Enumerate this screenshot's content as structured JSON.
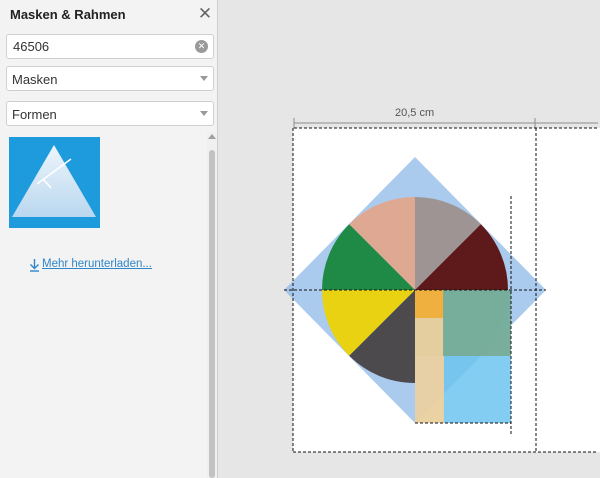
{
  "panel": {
    "title": "Masken & Rahmen",
    "close_icon": "close-icon",
    "search": {
      "value": "46506",
      "placeholder": ""
    },
    "category": "Masken",
    "subcategory": "Formen",
    "thumbnail_icon": "triangle-mask-icon",
    "download_icon": "download-arrow-icon",
    "download_label": "Mehr herunterladen..."
  },
  "canvas": {
    "ruler_label": "20,5 cm"
  },
  "colors": {
    "accent": "#1e9bdc",
    "link": "#2f86c9",
    "diamond": "#8fb9e8",
    "light_blue_rect": "#6cc4ef",
    "slice_rose": "#dfa893",
    "slice_taupe": "#9e9494",
    "slice_maroon": "#5e1a1a",
    "slice_green": "#1f8a45",
    "slice_yellow": "#e8d212",
    "slice_dark": "#4d4a4e",
    "slice_orange": "#f0b040",
    "slice_teal": "#78ab94",
    "beige_rect": "#ead0a0"
  }
}
